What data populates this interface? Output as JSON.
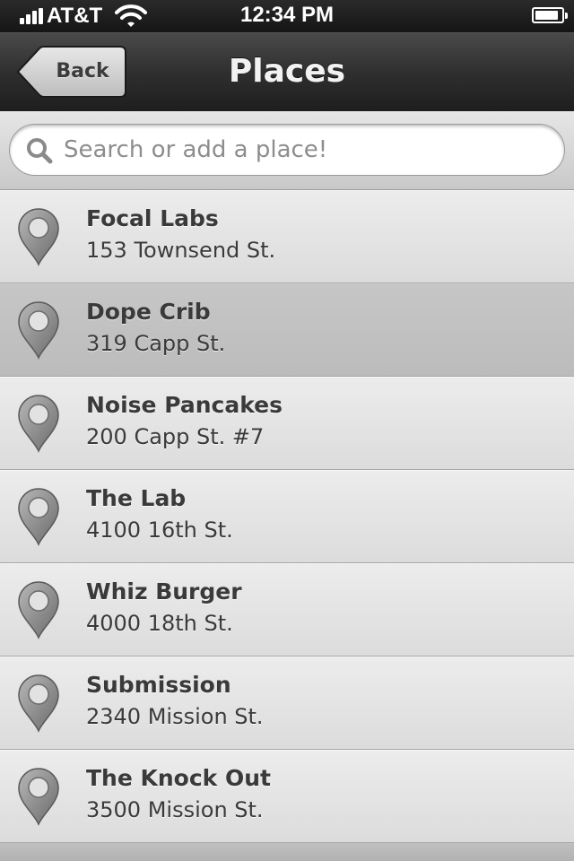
{
  "status_bar": {
    "carrier": "AT&T",
    "time": "12:34 PM",
    "signal_bars": 4,
    "battery_level": 0.9
  },
  "nav": {
    "back_label": "Back",
    "title": "Places"
  },
  "search": {
    "placeholder": "Search or add a place!",
    "value": ""
  },
  "places": [
    {
      "name": "Focal Labs",
      "address": "153 Townsend St.",
      "selected": false
    },
    {
      "name": "Dope Crib",
      "address": "319 Capp St.",
      "selected": true
    },
    {
      "name": "Noise Pancakes",
      "address": "200 Capp St. #7",
      "selected": false
    },
    {
      "name": "The Lab",
      "address": "4100 16th St.",
      "selected": false
    },
    {
      "name": "Whiz Burger",
      "address": "4000 18th St.",
      "selected": false
    },
    {
      "name": "Submission",
      "address": "2340 Mission St.",
      "selected": false
    },
    {
      "name": "The Knock Out",
      "address": "3500 Mission St.",
      "selected": false
    }
  ],
  "icons": {
    "list_item": "map-pin-icon",
    "search": "search-icon",
    "status": [
      "signal-icon",
      "wifi-icon",
      "battery-icon"
    ]
  },
  "colors": {
    "nav_bar": "#2f2f2f",
    "list_background": "#e4e4e4",
    "selected_row": "#c2c2c2",
    "text": "#3a3a3a"
  }
}
